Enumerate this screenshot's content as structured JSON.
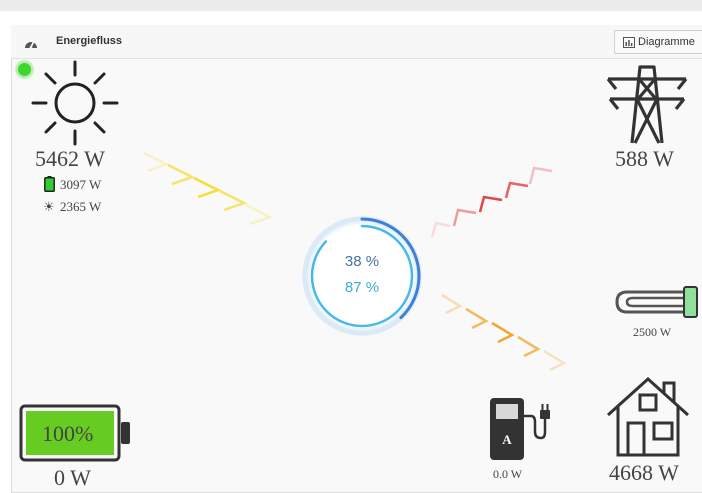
{
  "header": {
    "title": "Energiefluss",
    "diagram_button": "Diagramme"
  },
  "icons": {
    "dashboard": "speedometer-icon",
    "chart": "bar-chart-icon",
    "sun": "sun-icon",
    "grid": "power-pylon-icon",
    "heater": "heating-rod-icon",
    "house": "house-icon",
    "wallbox": "ev-charger-icon",
    "battery": "battery-icon",
    "status": "status-dot-icon"
  },
  "solar": {
    "total": "5462 W",
    "battery_part": "3097 W",
    "direct_part": "2365 W"
  },
  "grid": {
    "value": "588 W"
  },
  "heater": {
    "value": "2500 W"
  },
  "house": {
    "value": "4668 W"
  },
  "wallbox": {
    "letter": "A",
    "value": "0.0 W"
  },
  "battery": {
    "soc": "100%",
    "soc_fraction": 1.0,
    "value": "0 W"
  },
  "center": {
    "top_value": "38 %",
    "bottom_value": "87 %",
    "top_fraction": 0.38,
    "bottom_fraction": 0.87
  },
  "colors": {
    "status_green": "#3fd62e",
    "battery_fill": "#66cc22",
    "heater_green": "#8fe09a",
    "solar_arrow": "#f2dd2a",
    "grid_arrow": "#e23c3c",
    "house_arrow": "#f0a020",
    "ring_outer": "#3f7fd6",
    "ring_inner": "#46b9e8",
    "text_top": "#4a6fa8",
    "text_bottom": "#4aa8d8"
  }
}
